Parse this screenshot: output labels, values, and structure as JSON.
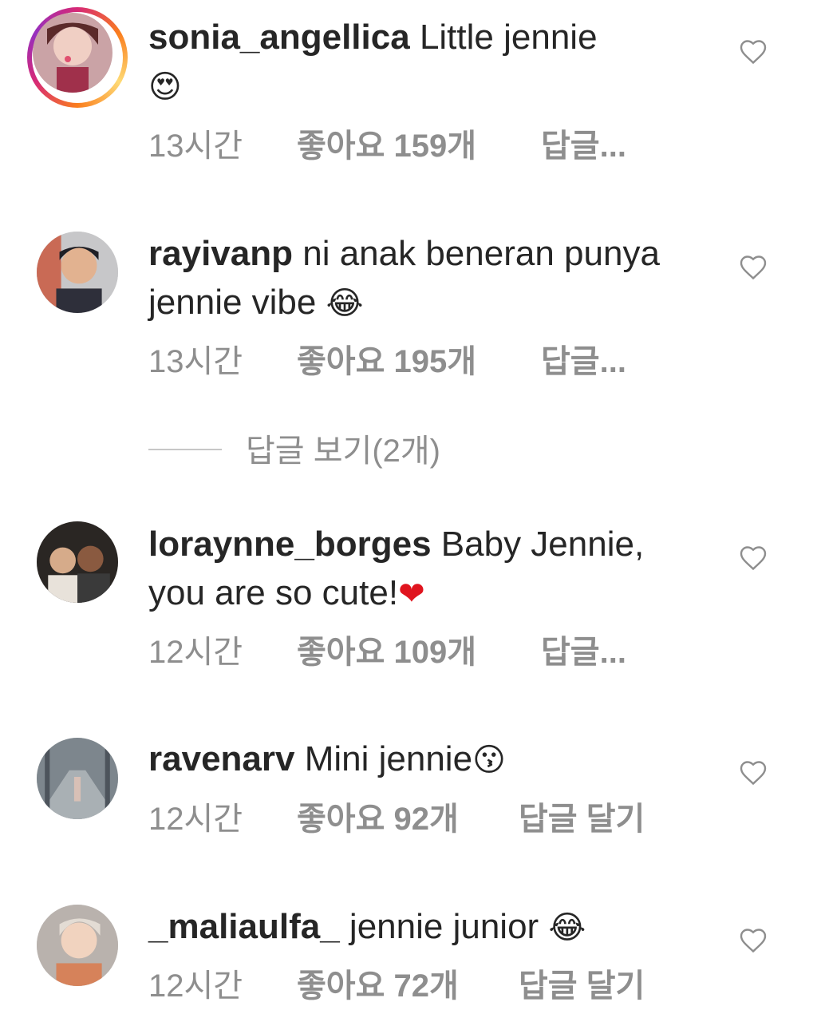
{
  "comments": [
    {
      "username": "sonia_angellica",
      "text": "Little jennie",
      "emoji": "😍",
      "time": "13시간",
      "likes": "좋아요 159개",
      "reply": "답글...",
      "has_story": true,
      "avatar_colors": [
        "#e8a0a8",
        "#7a3b3b"
      ]
    },
    {
      "username": "rayivanp",
      "text": "ni anak beneran punya jennie vibe",
      "emoji": "😂",
      "time": "13시간",
      "likes": "좋아요 195개",
      "reply": "답글...",
      "has_story": false,
      "avatar_colors": [
        "#d07d5a",
        "#2e2f3a"
      ]
    },
    {
      "username": "loraynne_borges",
      "text": "Baby Jennie, you are so cute!",
      "emoji": "❤",
      "time": "12시간",
      "likes": "좋아요 109개",
      "reply": "답글...",
      "has_story": false,
      "avatar_colors": [
        "#2a2623",
        "#c9a383"
      ]
    },
    {
      "username": "ravenarv",
      "text": "Mini jennie",
      "emoji": "😗",
      "time": "12시간",
      "likes": "좋아요 92개",
      "reply": "답글 달기",
      "has_story": false,
      "avatar_colors": [
        "#9aa2a8",
        "#4d545c"
      ]
    },
    {
      "username": "_maliaulfa_",
      "text": "jennie junior",
      "emoji": "😂",
      "time": "12시간",
      "likes": "좋아요 72개",
      "reply": "답글 달기",
      "has_story": false,
      "avatar_colors": [
        "#d9a489",
        "#7c5a4a"
      ]
    }
  ],
  "view_replies": "답글 보기(2개)",
  "colors": {
    "text": "#262626",
    "meta": "#8e8e8e",
    "heart": "#8e8e8e",
    "divider": "#c7c7c7"
  },
  "icons": {
    "like": "heart-outline-icon"
  }
}
